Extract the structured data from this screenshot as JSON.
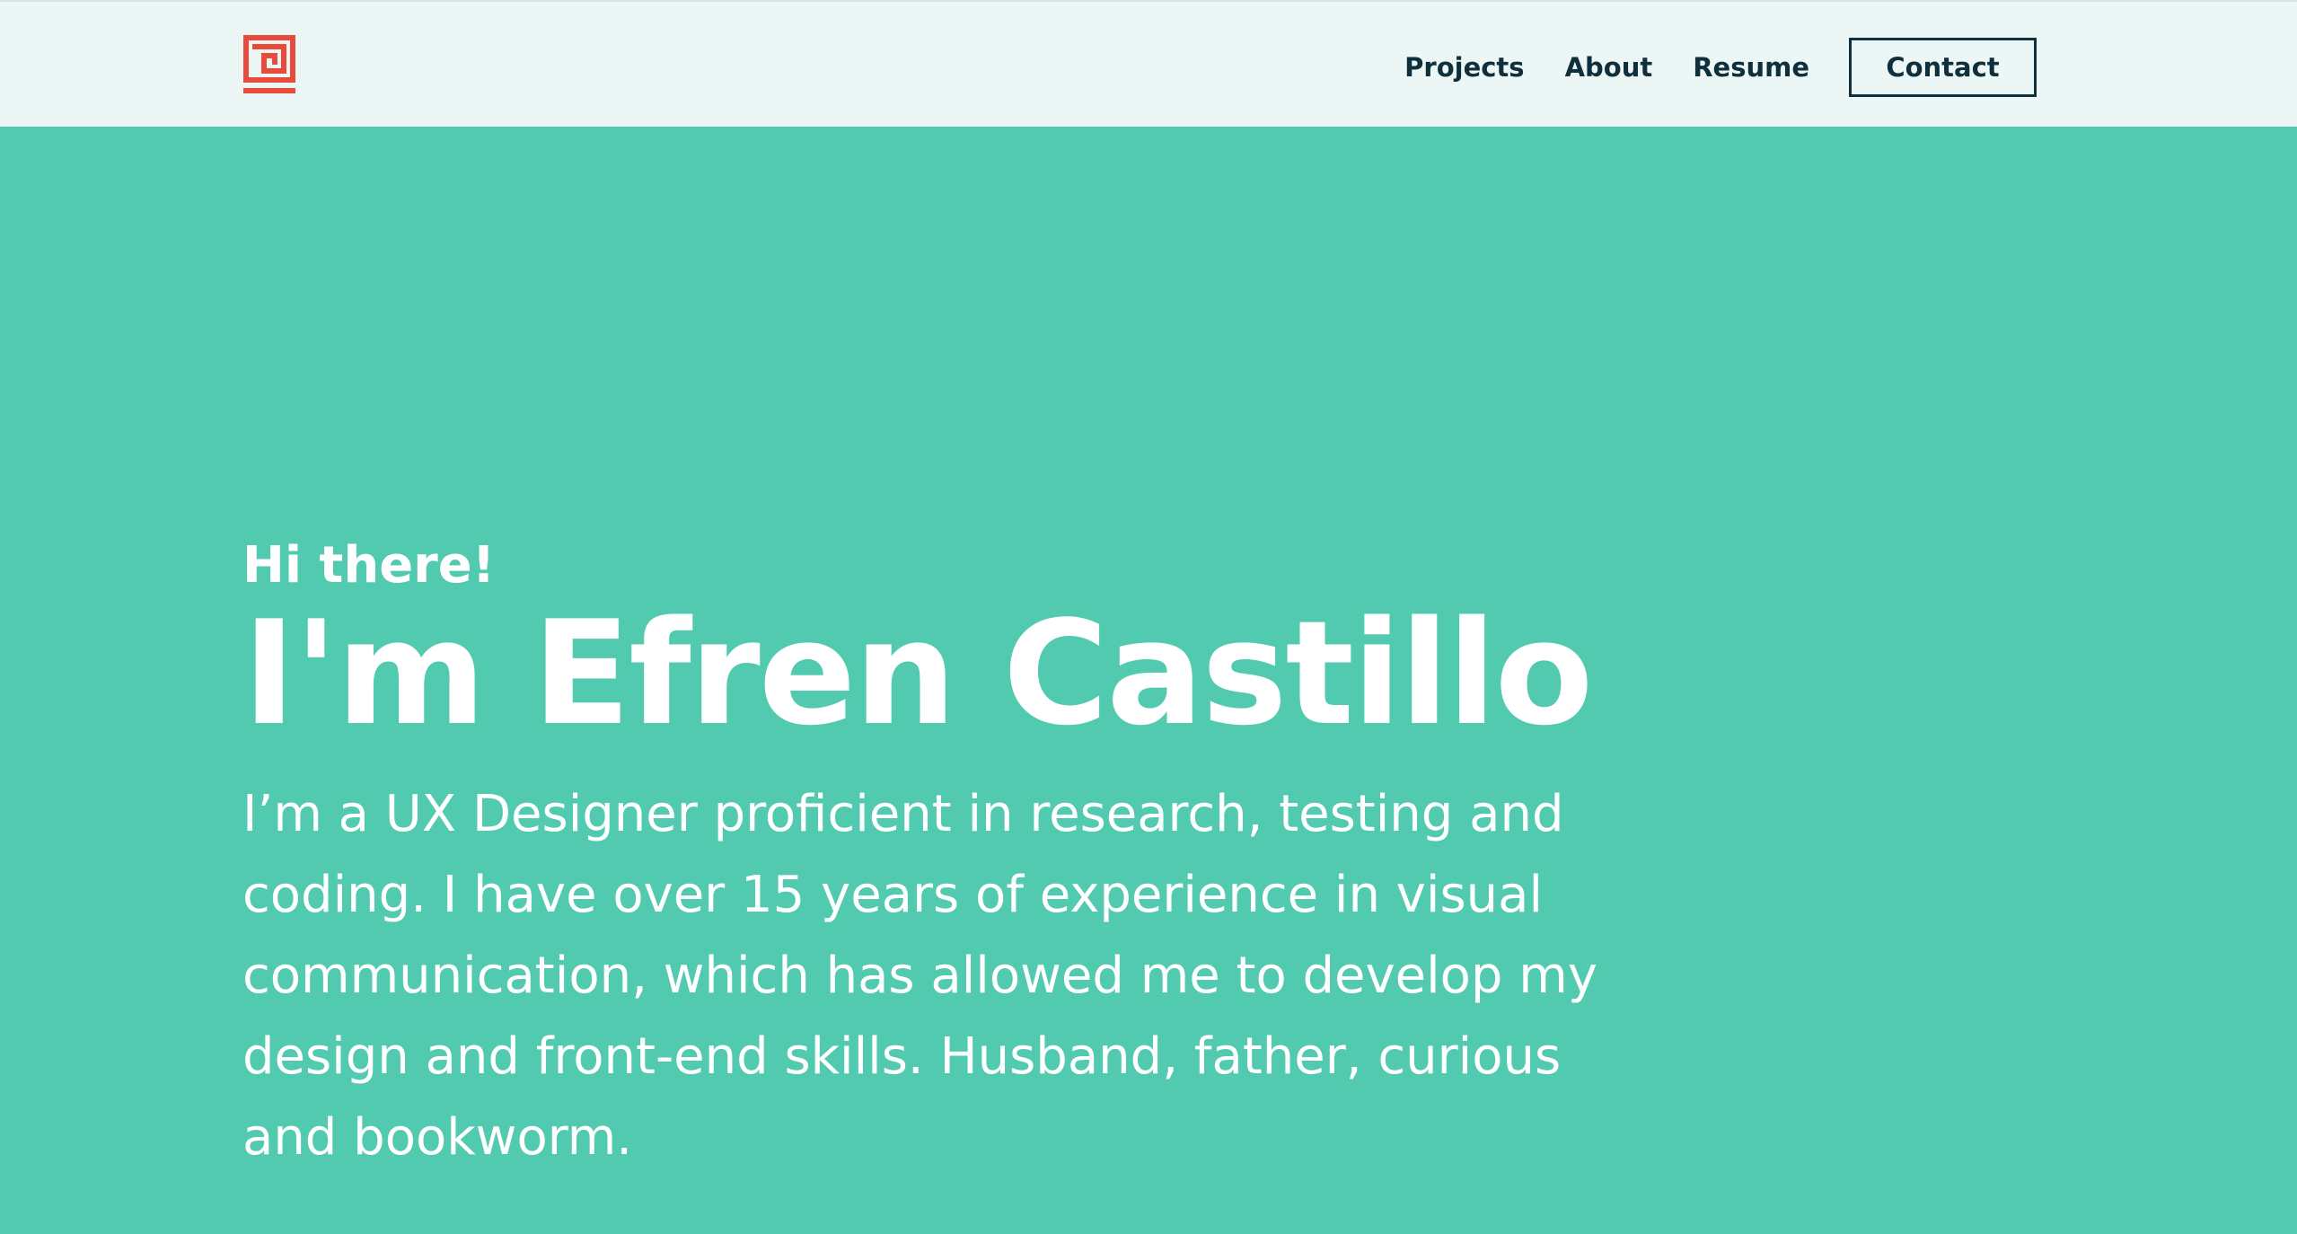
{
  "colors": {
    "hero_background": "#52cab0",
    "navbar_background": "#ecf7f5",
    "nav_text": "#0e2f3b",
    "logo": "#e84b3c",
    "hero_text": "#ffffff"
  },
  "header": {
    "logo_icon": "spiral-square-logo-icon",
    "nav": {
      "projects": "Projects",
      "about": "About",
      "resume": "Resume"
    },
    "contact_label": "Contact"
  },
  "hero": {
    "greeting": "Hi there!",
    "title": "I'm Efren Castillo",
    "description": "I’m a UX Designer proficient in research, testing and coding. I have over 15 years of experience in visual communication, which has allowed me to develop my design and front-end skills. Husband, father, curious and bookworm."
  }
}
